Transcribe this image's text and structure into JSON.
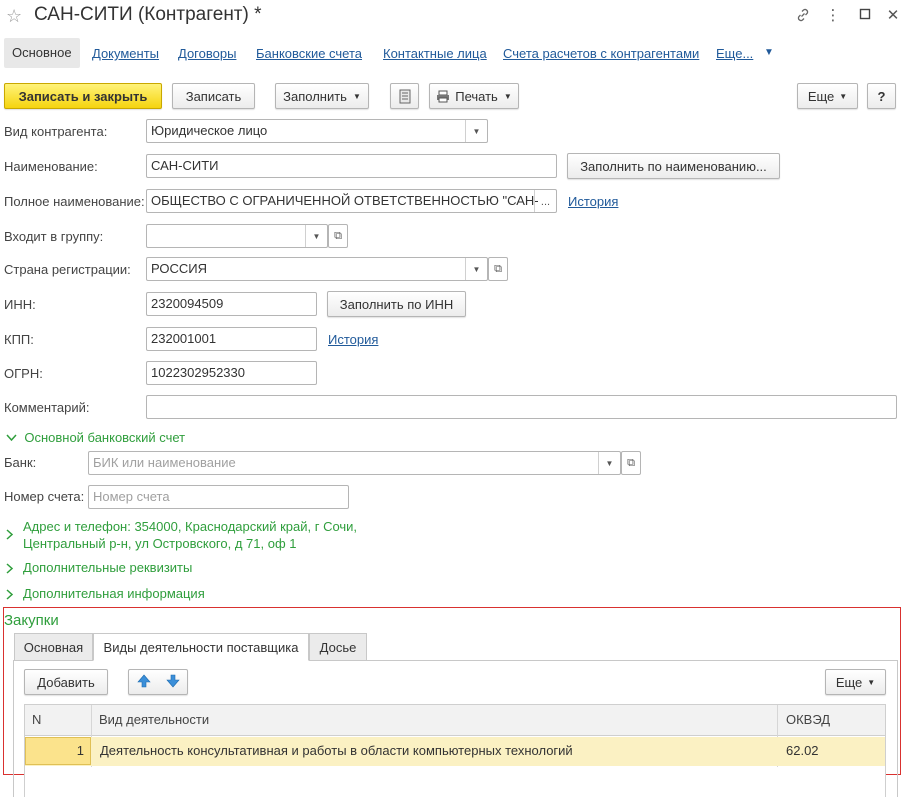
{
  "window": {
    "title": "САН-СИТИ (Контрагент) *"
  },
  "nav_tabs": {
    "active": "Основное",
    "items": [
      "Документы",
      "Договоры",
      "Банковские счета",
      "Контактные лица",
      "Счета расчетов с контрагентами",
      "Еще..."
    ]
  },
  "toolbar": {
    "save_close": "Записать и закрыть",
    "save": "Записать",
    "fill": "Заполнить",
    "print": "Печать",
    "more": "Еще",
    "help": "?"
  },
  "form": {
    "type_label": "Вид контрагента:",
    "type_value": "Юридическое лицо",
    "name_label": "Наименование:",
    "name_value": "САН-СИТИ",
    "fill_by_name": "Заполнить по наименованию...",
    "fullname_label": "Полное наименование:",
    "fullname_value": "ОБЩЕСТВО С ОГРАНИЧЕННОЙ ОТВЕТСТВЕННОСТЬЮ \"САН-",
    "history": "История",
    "group_label": "Входит в группу:",
    "group_value": "",
    "country_label": "Страна регистрации:",
    "country_value": "РОССИЯ",
    "inn_label": "ИНН:",
    "inn_value": "2320094509",
    "fill_by_inn": "Заполнить по ИНН",
    "kpp_label": "КПП:",
    "kpp_value": "232001001",
    "ogrn_label": "ОГРН:",
    "ogrn_value": "1022302952330",
    "comment_label": "Комментарий:",
    "comment_value": ""
  },
  "bank": {
    "section": "Основной банковский счет",
    "bank_label": "Банк:",
    "bank_placeholder": "БИК или наименование",
    "account_label": "Номер счета:",
    "account_placeholder": "Номер счета"
  },
  "sections": {
    "address_line1": "Адрес и телефон: 354000, Краснодарский край, г Сочи,",
    "address_line2": "Центральный р-н, ул Островского, д 71, оф 1",
    "extra_requisites": "Дополнительные реквизиты",
    "extra_info": "Дополнительная информация"
  },
  "purchases": {
    "title": "Закупки",
    "tabs": [
      "Основная",
      "Виды деятельности поставщика",
      "Досье"
    ],
    "add": "Добавить",
    "more": "Еще",
    "columns": [
      "N",
      "Вид деятельности",
      "ОКВЭД"
    ],
    "rows": [
      {
        "n": "1",
        "activity": "Деятельность консультативная и работы в области компьютерных технологий",
        "okved": "62.02"
      }
    ]
  },
  "colors": {
    "accent_yellow": "#f5d40f",
    "link_blue": "#215a9a",
    "section_green": "#2f9e3c",
    "highlight_red": "#d9312f",
    "row_selected": "#fbf1c3"
  }
}
